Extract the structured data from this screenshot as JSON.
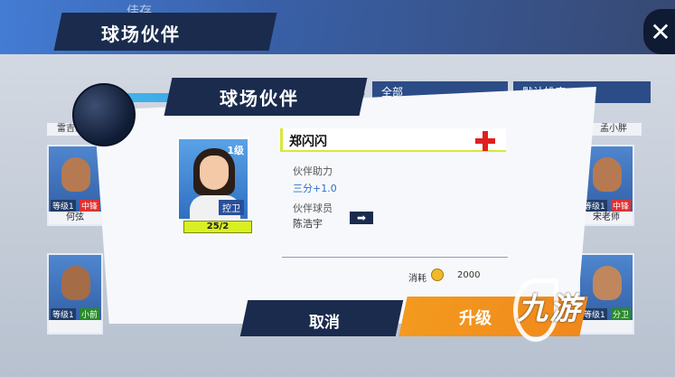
{
  "background": {
    "watermark": "佳存",
    "title": "球场伙伴",
    "filter_left": "全部",
    "filter_right": "默认排序",
    "cards": [
      {
        "name": "雷吉杰克",
        "level": "",
        "pos": ""
      },
      {
        "name": "何弦",
        "level": "等级1",
        "pos": "中锋"
      },
      {
        "name": "",
        "level": "等级1",
        "pos": "小前"
      },
      {
        "name": "孟小胖",
        "level": "",
        "pos": ""
      },
      {
        "name": "宋老师",
        "level": "等级1",
        "pos": "中锋"
      },
      {
        "name": "",
        "level": "等级1",
        "pos": "分卫"
      }
    ]
  },
  "dialog": {
    "title": "球场伙伴",
    "player_name": "郑闪闪",
    "portrait_level": "1级",
    "portrait_position": "控卫",
    "progress_text": "25/2",
    "assist_label": "伙伴助力",
    "assist_value": "三分+1.0",
    "partner_label": "伙伴球员",
    "partner_value": "陈浩宇",
    "cost_label": "消耗",
    "cost_value": "2000",
    "cancel_label": "取消",
    "upgrade_label": "升级",
    "arrow_symbol": "➡",
    "cancel_color": "#1a2b4d",
    "upgrade_color": "#f39a1f"
  },
  "logo": {
    "text": "九游"
  },
  "close_symbol": "✕"
}
